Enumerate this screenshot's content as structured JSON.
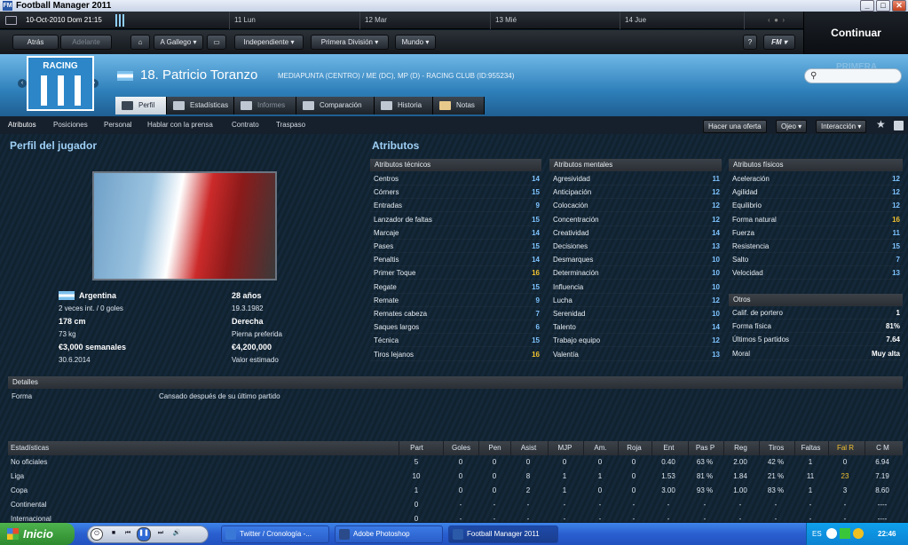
{
  "window": {
    "title": "Football Manager 2011",
    "minimize": "_",
    "maximize": "□",
    "close": "✕"
  },
  "datebar": {
    "current": "10-Oct-2010 Dom 21:15",
    "days": [
      "11 Lun",
      "12 Mar",
      "13 Mié",
      "14 Jue"
    ]
  },
  "continue_label": "Continuar",
  "nav": {
    "back": "Atrás",
    "forward": "Adelante",
    "manager": "A Gallego",
    "club": "Independiente",
    "league": "Primera División",
    "world": "Mundo",
    "help": "?",
    "fm_menu": "FM"
  },
  "player": {
    "club_name": "RACING",
    "name": "18. Patricio Toranzo",
    "description": "MEDIAPUNTA (CENTRO) / ME (DC), MP (D) - RACING CLUB (ID:955234)"
  },
  "search": {
    "icon": "search-icon",
    "ghost_text": "PRIMERA DIVISIÓN"
  },
  "tabs": [
    {
      "label": "Perfil",
      "icon": "profile-icon"
    },
    {
      "label": "Estadísticas",
      "icon": "stats-icon"
    },
    {
      "label": "Informes",
      "icon": "reports-icon"
    },
    {
      "label": "Comparación",
      "icon": "compare-icon"
    },
    {
      "label": "Historia",
      "icon": "history-icon"
    },
    {
      "label": "Notas",
      "icon": "notes-icon"
    }
  ],
  "subnav": [
    "Atributos",
    "Posiciones",
    "Personal",
    "Hablar con la prensa",
    "Contrato",
    "Traspaso"
  ],
  "actions": {
    "offer": "Hacer una oferta",
    "scout": "Ojeo",
    "interaction": "Interacción"
  },
  "profile": {
    "title": "Perfil del jugador",
    "nationality": "Argentina",
    "caps": "2 veces int. / 0 goles",
    "age": "28 años",
    "dob": "19.3.1982",
    "height": "178 cm",
    "foot": "Derecha",
    "weight": "73 kg",
    "foot_label": "Pierna preferida",
    "wage": "€3,000 semanales",
    "value": "€4,200,000",
    "contract_end": "30.6.2014",
    "value_label": "Valor estimado"
  },
  "attributes": {
    "title": "Atributos",
    "technical": {
      "header": "Atributos técnicos",
      "rows": [
        {
          "name": "Centros",
          "value": "14"
        },
        {
          "name": "Córners",
          "value": "15"
        },
        {
          "name": "Entradas",
          "value": "9"
        },
        {
          "name": "Lanzador de faltas",
          "value": "15"
        },
        {
          "name": "Marcaje",
          "value": "14"
        },
        {
          "name": "Pases",
          "value": "15"
        },
        {
          "name": "Penaltis",
          "value": "14"
        },
        {
          "name": "Primer Toque",
          "value": "16"
        },
        {
          "name": "Regate",
          "value": "15"
        },
        {
          "name": "Remate",
          "value": "9"
        },
        {
          "name": "Remates cabeza",
          "value": "7"
        },
        {
          "name": "Saques largos",
          "value": "6"
        },
        {
          "name": "Técnica",
          "value": "15"
        },
        {
          "name": "Tiros lejanos",
          "value": "16"
        }
      ]
    },
    "mental": {
      "header": "Atributos mentales",
      "rows": [
        {
          "name": "Agresividad",
          "value": "11"
        },
        {
          "name": "Anticipación",
          "value": "12"
        },
        {
          "name": "Colocación",
          "value": "12"
        },
        {
          "name": "Concentración",
          "value": "12"
        },
        {
          "name": "Creatividad",
          "value": "14"
        },
        {
          "name": "Decisiones",
          "value": "13"
        },
        {
          "name": "Desmarques",
          "value": "10"
        },
        {
          "name": "Determinación",
          "value": "10"
        },
        {
          "name": "Influencia",
          "value": "10"
        },
        {
          "name": "Lucha",
          "value": "12"
        },
        {
          "name": "Serenidad",
          "value": "10"
        },
        {
          "name": "Talento",
          "value": "14"
        },
        {
          "name": "Trabajo equipo",
          "value": "12"
        },
        {
          "name": "Valentía",
          "value": "13"
        }
      ]
    },
    "physical": {
      "header": "Atributos físicos",
      "rows": [
        {
          "name": "Aceleración",
          "value": "12"
        },
        {
          "name": "Agilidad",
          "value": "12"
        },
        {
          "name": "Equilibrio",
          "value": "12"
        },
        {
          "name": "Forma natural",
          "value": "16"
        },
        {
          "name": "Fuerza",
          "value": "11"
        },
        {
          "name": "Resistencia",
          "value": "15"
        },
        {
          "name": "Salto",
          "value": "7"
        },
        {
          "name": "Velocidad",
          "value": "13"
        }
      ]
    },
    "other": {
      "header": "Otros",
      "rows": [
        {
          "name": "Calif. de portero",
          "value": "1"
        },
        {
          "name": "Forma física",
          "value": "81%"
        },
        {
          "name": "Últimos 5 partidos",
          "value": "7.64"
        },
        {
          "name": "Moral",
          "value": "Muy alta"
        }
      ]
    }
  },
  "details": {
    "header": "Detalles",
    "form_label": "Forma",
    "form_value": "Cansado después de su último partido"
  },
  "stats": {
    "header": "Estadísticas",
    "columns": [
      "Part",
      "Goles",
      "Pen",
      "Asist",
      "MJP",
      "Am.",
      "Roja",
      "Ent",
      "Pas P",
      "Reg",
      "Tiros",
      "Faltas",
      "Fal R",
      "C M"
    ],
    "rows": [
      {
        "label": "No oficiales",
        "cells": [
          "5",
          "0",
          "0",
          "0",
          "0",
          "0",
          "0",
          "0.40",
          "63 %",
          "2.00",
          "42 %",
          "1",
          "0",
          "6.94"
        ]
      },
      {
        "label": "Liga",
        "cells": [
          "10",
          "0",
          "0",
          "8",
          "1",
          "1",
          "0",
          "1.53",
          "81 %",
          "1.84",
          "21 %",
          "11",
          "23",
          "7.19"
        ]
      },
      {
        "label": "Copa",
        "cells": [
          "1",
          "0",
          "0",
          "2",
          "1",
          "0",
          "0",
          "3.00",
          "93 %",
          "1.00",
          "83 %",
          "1",
          "3",
          "8.60"
        ]
      },
      {
        "label": "Continental",
        "cells": [
          "0",
          "-",
          "-",
          "-",
          "-",
          "-",
          "-",
          "-",
          "-",
          "-",
          "-",
          "-",
          "-",
          "----"
        ]
      },
      {
        "label": "Internacional",
        "cells": [
          "0",
          "-",
          "-",
          "-",
          "-",
          "-",
          "-",
          "-",
          "-",
          "-",
          "-",
          "-",
          "-",
          "----"
        ]
      }
    ]
  },
  "taskbar": {
    "start": "Inicio",
    "buttons": [
      {
        "label": "Twitter / Cronología -...",
        "color": "#3a78d8"
      },
      {
        "label": "Adobe Photoshop",
        "color": "#2a4a8a"
      },
      {
        "label": "Football Manager 2011",
        "color": "#2b5aa8"
      }
    ],
    "lang": "ES",
    "clock": "22:46"
  },
  "colors": {
    "accent": "#9fd0f6",
    "highlight": "#f2c230",
    "attr_value": "#7ec3ff",
    "header_blue": "#2e7fba"
  }
}
